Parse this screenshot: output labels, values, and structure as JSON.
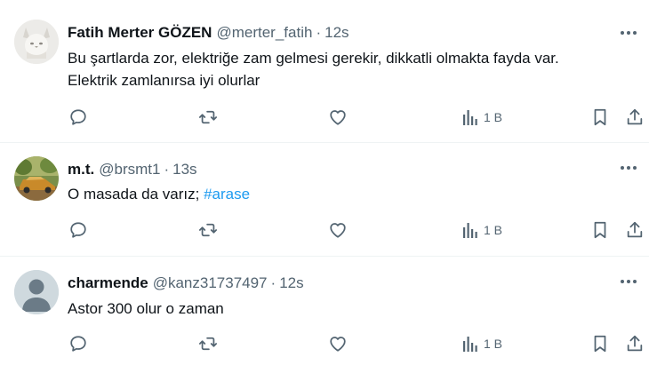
{
  "tweets": [
    {
      "display_name": "Fatih Merter GÖZEN",
      "handle": "@merter_fatih",
      "separator": "·",
      "time": "12s",
      "text_line1": "Bu şartlarda zor, elektriğe zam gelmesi gerekir, dikkatli olmakta fayda var.",
      "text_line2": "Elektrik zamlanırsa iyi olurlar",
      "views": "1 B",
      "avatar_icon": "white-lynx-avatar"
    },
    {
      "display_name": "m.t.",
      "handle": "@brsmt1",
      "separator": "·",
      "time": "13s",
      "text": "O masada da varız; ",
      "hashtag": "#arase",
      "views": "1 B",
      "avatar_icon": "vintage-car-avatar"
    },
    {
      "display_name": "charmende",
      "handle": "@kanz31737497",
      "separator": "·",
      "time": "12s",
      "text": "Astor 300 olur o zaman",
      "views": "1 B",
      "avatar_icon": "default-person-avatar"
    }
  ],
  "colors": {
    "text": "#0f1419",
    "secondary": "#536471",
    "link": "#1d9bf0",
    "divider": "#eff3f4"
  }
}
